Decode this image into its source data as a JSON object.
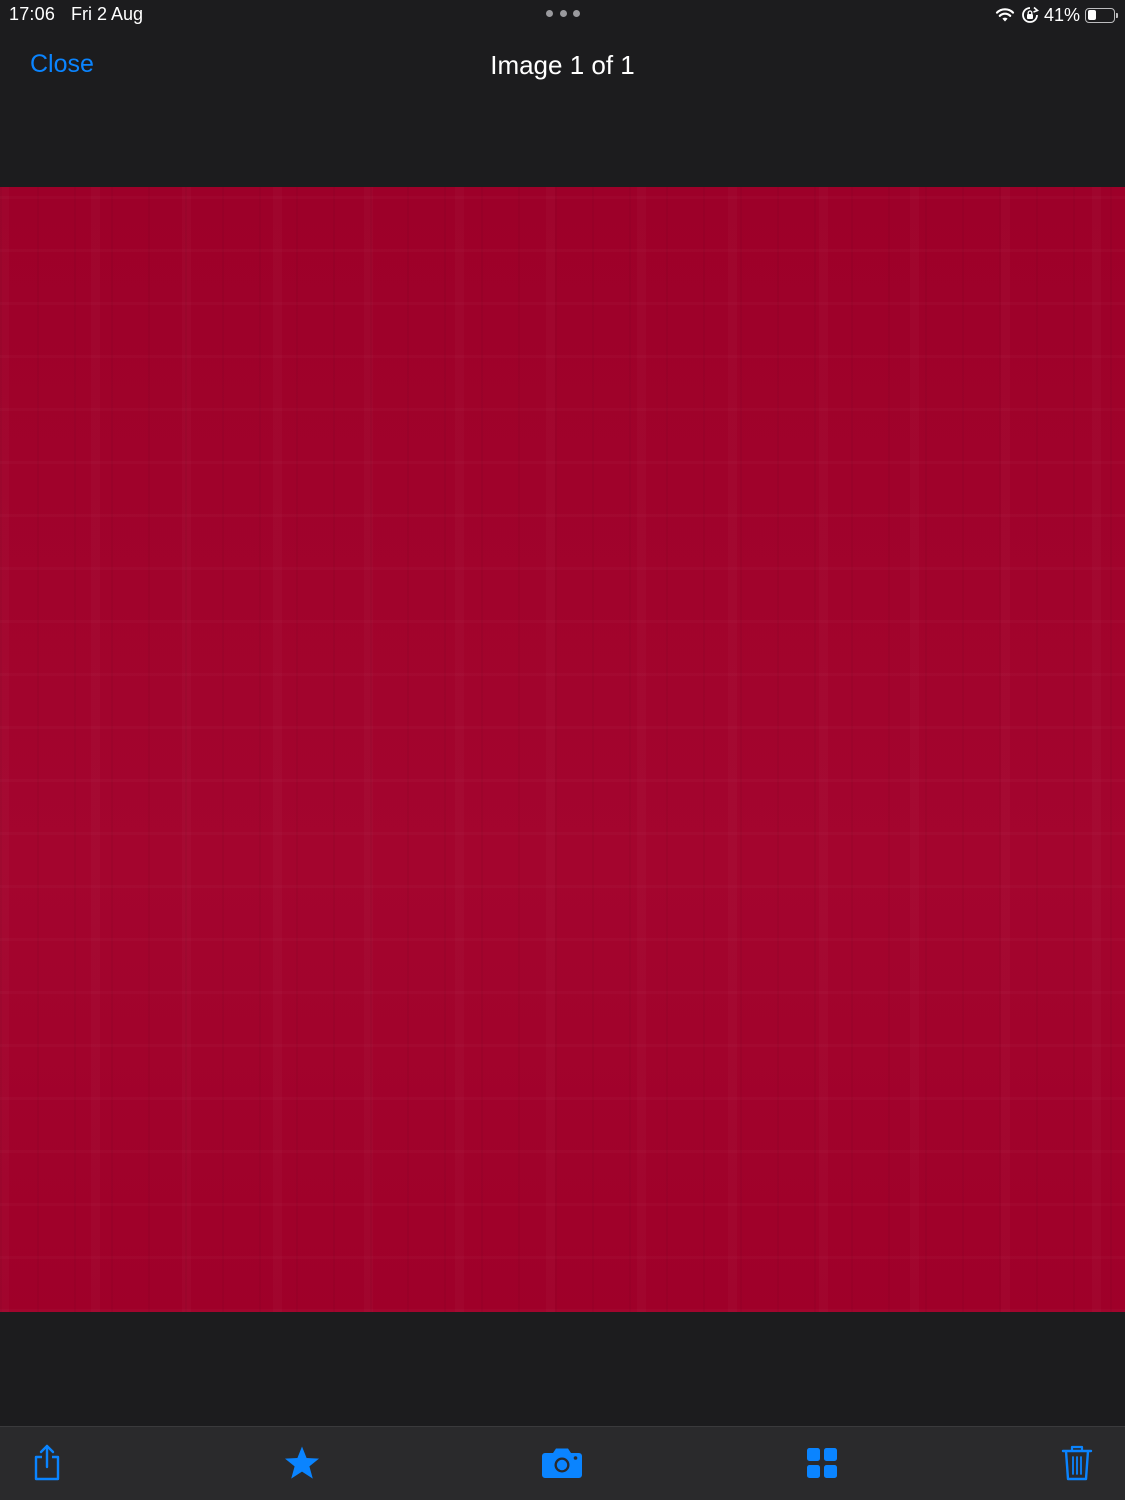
{
  "status_bar": {
    "time": "17:06",
    "date": "Fri 2 Aug",
    "battery_percent": "41%",
    "battery_level": 0.41,
    "icons": [
      "wifi-icon",
      "lock-rotation-icon",
      "battery-icon"
    ]
  },
  "nav": {
    "close_label": "Close",
    "title": "Image 1 of 1"
  },
  "image": {
    "color": "#a2002a"
  },
  "toolbar": {
    "items": [
      {
        "name": "share-button",
        "icon": "share-icon"
      },
      {
        "name": "favorite-button",
        "icon": "star-icon"
      },
      {
        "name": "camera-button",
        "icon": "camera-icon"
      },
      {
        "name": "grid-button",
        "icon": "grid-icon"
      },
      {
        "name": "delete-button",
        "icon": "trash-icon"
      }
    ]
  },
  "colors": {
    "accent": "#0a84ff",
    "background": "#1c1c1e",
    "toolbar": "#2a2a2c",
    "text": "#ffffff"
  }
}
